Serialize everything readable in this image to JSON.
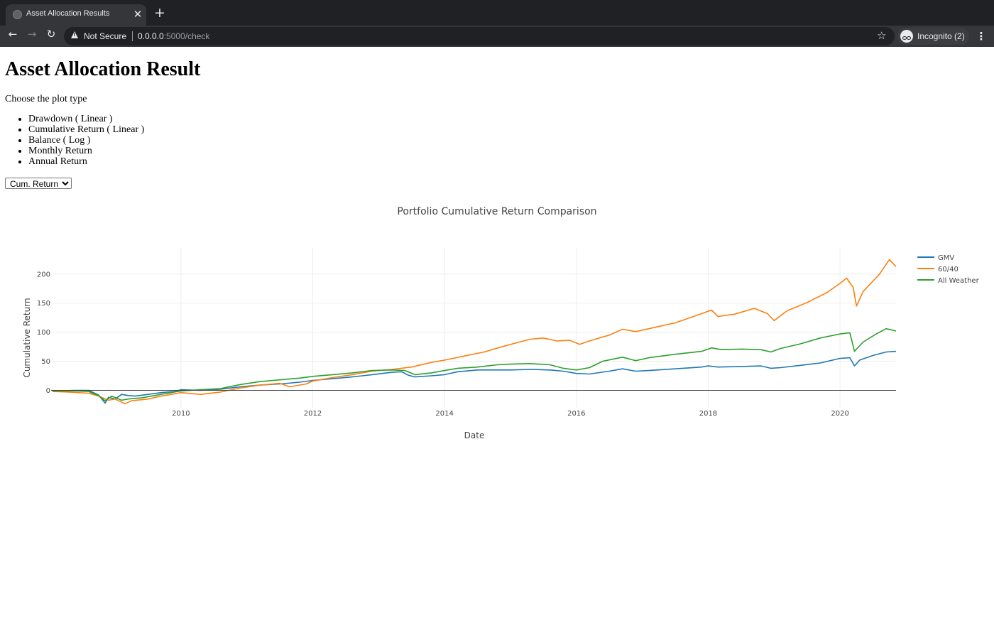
{
  "browser": {
    "tab_title": "Asset Allocation Results",
    "tab_close": "✕",
    "new_tab": "+",
    "back": "←",
    "forward": "→",
    "reload": "↻",
    "security_label": "Not Secure",
    "url_host": "0.0.0.0",
    "url_rest": ":5000/check",
    "star": "☆",
    "incognito_label": "Incognito (2)",
    "menu": "⋮"
  },
  "page": {
    "heading": "Asset Allocation Result",
    "choose_label": "Choose the plot type",
    "plot_types": [
      "Drawdown ( Linear )",
      "Cumulative Return ( Linear )",
      "Balance ( Log )",
      "Monthly Return",
      "Annual Return"
    ],
    "select_value": "Cum. Return"
  },
  "chart_data": {
    "type": "line",
    "title": "Portfolio Cumulative Return Comparison",
    "xlabel": "Date",
    "ylabel": "Cumulative Return",
    "xlim": [
      2008.03,
      2020.85
    ],
    "ylim": [
      -30,
      245
    ],
    "x_ticks": [
      "2010",
      "2012",
      "2014",
      "2016",
      "2018",
      "2020"
    ],
    "y_ticks": [
      "0",
      "50",
      "100",
      "150",
      "200"
    ],
    "grid": true,
    "legend_position": "right",
    "series": [
      {
        "name": "GMV",
        "color": "#1f77b4",
        "points": [
          [
            2008.05,
            -1
          ],
          [
            2008.4,
            0
          ],
          [
            2008.6,
            0
          ],
          [
            2008.75,
            -8
          ],
          [
            2008.85,
            -22
          ],
          [
            2008.9,
            -12
          ],
          [
            2009.0,
            -15
          ],
          [
            2009.1,
            -7
          ],
          [
            2009.2,
            -9
          ],
          [
            2009.3,
            -10
          ],
          [
            2009.5,
            -7
          ],
          [
            2009.7,
            -4
          ],
          [
            2009.9,
            -2
          ],
          [
            2010.0,
            1
          ],
          [
            2010.3,
            0
          ],
          [
            2010.6,
            2
          ],
          [
            2010.9,
            6
          ],
          [
            2011.2,
            9
          ],
          [
            2011.5,
            11
          ],
          [
            2011.8,
            14
          ],
          [
            2012.0,
            17
          ],
          [
            2012.3,
            20
          ],
          [
            2012.6,
            23
          ],
          [
            2012.9,
            27
          ],
          [
            2013.2,
            31
          ],
          [
            2013.35,
            32
          ],
          [
            2013.45,
            26
          ],
          [
            2013.55,
            23
          ],
          [
            2013.8,
            25
          ],
          [
            2014.0,
            27
          ],
          [
            2014.2,
            32
          ],
          [
            2014.5,
            35
          ],
          [
            2014.8,
            35
          ],
          [
            2015.0,
            35
          ],
          [
            2015.3,
            36
          ],
          [
            2015.6,
            35
          ],
          [
            2015.8,
            33
          ],
          [
            2016.0,
            29
          ],
          [
            2016.2,
            28
          ],
          [
            2016.5,
            33
          ],
          [
            2016.7,
            37
          ],
          [
            2016.9,
            33
          ],
          [
            2017.1,
            34
          ],
          [
            2017.5,
            37
          ],
          [
            2017.9,
            40
          ],
          [
            2018.0,
            42
          ],
          [
            2018.15,
            40
          ],
          [
            2018.5,
            41
          ],
          [
            2018.8,
            42
          ],
          [
            2018.95,
            38
          ],
          [
            2019.1,
            39
          ],
          [
            2019.4,
            43
          ],
          [
            2019.7,
            47
          ],
          [
            2020.0,
            55
          ],
          [
            2020.15,
            56
          ],
          [
            2020.22,
            42
          ],
          [
            2020.3,
            52
          ],
          [
            2020.5,
            60
          ],
          [
            2020.7,
            66
          ],
          [
            2020.85,
            67
          ]
        ]
      },
      {
        "name": "60/40",
        "color": "#ff7f0e",
        "points": [
          [
            2008.05,
            -2
          ],
          [
            2008.3,
            -3
          ],
          [
            2008.6,
            -5
          ],
          [
            2008.75,
            -10
          ],
          [
            2008.9,
            -17
          ],
          [
            2009.0,
            -15
          ],
          [
            2009.15,
            -23
          ],
          [
            2009.25,
            -18
          ],
          [
            2009.5,
            -15
          ],
          [
            2009.7,
            -10
          ],
          [
            2009.9,
            -6
          ],
          [
            2010.0,
            -4
          ],
          [
            2010.3,
            -7
          ],
          [
            2010.6,
            -3
          ],
          [
            2010.9,
            4
          ],
          [
            2011.2,
            9
          ],
          [
            2011.5,
            12
          ],
          [
            2011.65,
            6
          ],
          [
            2011.9,
            11
          ],
          [
            2012.0,
            16
          ],
          [
            2012.3,
            22
          ],
          [
            2012.6,
            27
          ],
          [
            2012.9,
            33
          ],
          [
            2013.2,
            36
          ],
          [
            2013.5,
            40
          ],
          [
            2013.8,
            48
          ],
          [
            2014.0,
            52
          ],
          [
            2014.3,
            59
          ],
          [
            2014.6,
            66
          ],
          [
            2014.9,
            76
          ],
          [
            2015.1,
            82
          ],
          [
            2015.3,
            88
          ],
          [
            2015.5,
            90
          ],
          [
            2015.7,
            85
          ],
          [
            2015.9,
            86
          ],
          [
            2016.05,
            79
          ],
          [
            2016.2,
            85
          ],
          [
            2016.5,
            95
          ],
          [
            2016.7,
            105
          ],
          [
            2016.9,
            101
          ],
          [
            2017.1,
            106
          ],
          [
            2017.5,
            116
          ],
          [
            2017.9,
            132
          ],
          [
            2018.05,
            138
          ],
          [
            2018.15,
            127
          ],
          [
            2018.4,
            131
          ],
          [
            2018.7,
            141
          ],
          [
            2018.9,
            132
          ],
          [
            2019.0,
            120
          ],
          [
            2019.2,
            137
          ],
          [
            2019.5,
            151
          ],
          [
            2019.8,
            168
          ],
          [
            2020.0,
            184
          ],
          [
            2020.1,
            193
          ],
          [
            2020.2,
            177
          ],
          [
            2020.25,
            145
          ],
          [
            2020.35,
            170
          ],
          [
            2020.6,
            200
          ],
          [
            2020.75,
            225
          ],
          [
            2020.85,
            213
          ]
        ]
      },
      {
        "name": "All Weather",
        "color": "#2ca02c",
        "points": [
          [
            2008.05,
            -1
          ],
          [
            2008.4,
            -1
          ],
          [
            2008.6,
            -2
          ],
          [
            2008.75,
            -9
          ],
          [
            2008.85,
            -18
          ],
          [
            2008.95,
            -10
          ],
          [
            2009.1,
            -17
          ],
          [
            2009.2,
            -15
          ],
          [
            2009.4,
            -13
          ],
          [
            2009.6,
            -9
          ],
          [
            2009.8,
            -5
          ],
          [
            2010.0,
            -1
          ],
          [
            2010.3,
            1
          ],
          [
            2010.6,
            3
          ],
          [
            2010.9,
            10
          ],
          [
            2011.2,
            15
          ],
          [
            2011.5,
            18
          ],
          [
            2011.8,
            21
          ],
          [
            2012.0,
            24
          ],
          [
            2012.3,
            27
          ],
          [
            2012.6,
            30
          ],
          [
            2012.9,
            34
          ],
          [
            2013.2,
            35
          ],
          [
            2013.4,
            34
          ],
          [
            2013.55,
            27
          ],
          [
            2013.8,
            30
          ],
          [
            2014.0,
            34
          ],
          [
            2014.2,
            38
          ],
          [
            2014.5,
            40
          ],
          [
            2014.8,
            44
          ],
          [
            2015.0,
            45
          ],
          [
            2015.3,
            46
          ],
          [
            2015.6,
            44
          ],
          [
            2015.8,
            38
          ],
          [
            2016.0,
            35
          ],
          [
            2016.2,
            39
          ],
          [
            2016.4,
            50
          ],
          [
            2016.7,
            57
          ],
          [
            2016.9,
            51
          ],
          [
            2017.1,
            56
          ],
          [
            2017.5,
            62
          ],
          [
            2017.9,
            67
          ],
          [
            2018.05,
            73
          ],
          [
            2018.2,
            70
          ],
          [
            2018.5,
            71
          ],
          [
            2018.8,
            70
          ],
          [
            2018.95,
            66
          ],
          [
            2019.1,
            72
          ],
          [
            2019.4,
            80
          ],
          [
            2019.7,
            90
          ],
          [
            2020.0,
            97
          ],
          [
            2020.15,
            99
          ],
          [
            2020.22,
            67
          ],
          [
            2020.35,
            83
          ],
          [
            2020.55,
            97
          ],
          [
            2020.7,
            106
          ],
          [
            2020.85,
            102
          ]
        ]
      }
    ]
  }
}
